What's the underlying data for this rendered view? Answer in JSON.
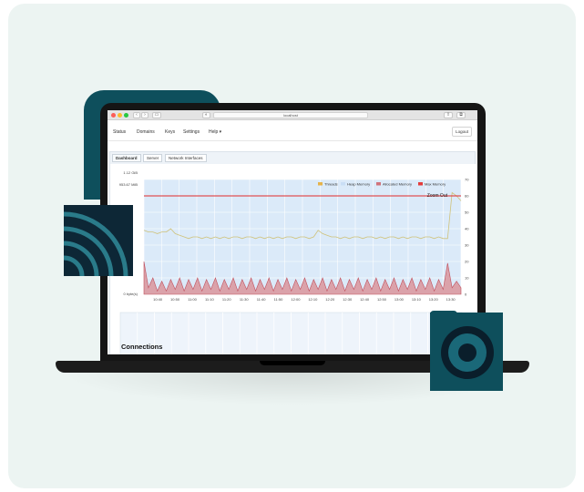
{
  "browser": {
    "url": "localhost",
    "back_glyph": "‹",
    "forward_glyph": "›"
  },
  "navbar": {
    "items": [
      "Status",
      "Domains",
      "Keys",
      "Settings",
      "Help ▾"
    ],
    "logout_label": "Logout"
  },
  "tabs": [
    "Dashboard",
    "Server",
    "Network Interfaces"
  ],
  "chart_data": {
    "type": "line",
    "legend": [
      "Threads",
      "Heap Memory",
      "Allocated Memory",
      "Max Memory"
    ],
    "legend_colors": [
      "#e6b34a",
      "#c9def5",
      "#d0737b",
      "#e43b3b"
    ],
    "legend_position": "top-right",
    "zoom_label": "Zoom Out",
    "y_left_ticks": [
      "1.12 GiB",
      "953.67 MiB",
      "0 byte(s)"
    ],
    "y_right_ticks": [
      "70",
      "60",
      "50",
      "40",
      "30",
      "20",
      "10",
      "0"
    ],
    "y_right_range": [
      0,
      70
    ],
    "x_ticks": [
      "10:40",
      "10:50",
      "11:00",
      "11:10",
      "11:20",
      "11:30",
      "11:40",
      "11:50",
      "12:00",
      "12:10",
      "12:20",
      "12:30",
      "12:40",
      "12:50",
      "13:00",
      "13:10",
      "13:20",
      "13:30"
    ],
    "max_memory": 60,
    "threads": [
      39,
      38,
      38,
      37,
      38,
      38,
      40,
      37,
      36,
      35,
      34,
      35,
      35,
      34,
      35,
      34,
      35,
      34,
      35,
      34,
      35,
      35,
      34,
      35,
      35,
      34,
      35,
      34,
      35,
      34,
      35,
      34,
      35,
      35,
      34,
      35,
      35,
      34,
      35,
      39,
      37,
      36,
      35,
      35,
      34,
      35,
      34,
      35,
      35,
      34,
      35,
      35,
      34,
      35,
      34,
      35,
      35,
      34,
      35,
      34,
      35,
      35,
      34,
      35,
      35,
      34,
      35,
      34,
      34,
      62,
      60,
      57
    ],
    "allocated": [
      20,
      4,
      10,
      2,
      8,
      2,
      9,
      3,
      10,
      2,
      9,
      3,
      10,
      2,
      9,
      3,
      10,
      2,
      9,
      3,
      10,
      2,
      9,
      3,
      10,
      2,
      9,
      3,
      10,
      2,
      9,
      3,
      10,
      2,
      9,
      3,
      10,
      2,
      9,
      3,
      10,
      2,
      9,
      3,
      10,
      2,
      9,
      3,
      10,
      2,
      9,
      3,
      10,
      2,
      9,
      3,
      10,
      2,
      9,
      3,
      10,
      2,
      9,
      3,
      10,
      2,
      9,
      3,
      19,
      4,
      8,
      4
    ]
  },
  "connections": {
    "title": "Connections"
  },
  "colors": {
    "teal": "#0e4f5c",
    "navy": "#0d2736",
    "card_bg": "#ecf4f2"
  }
}
